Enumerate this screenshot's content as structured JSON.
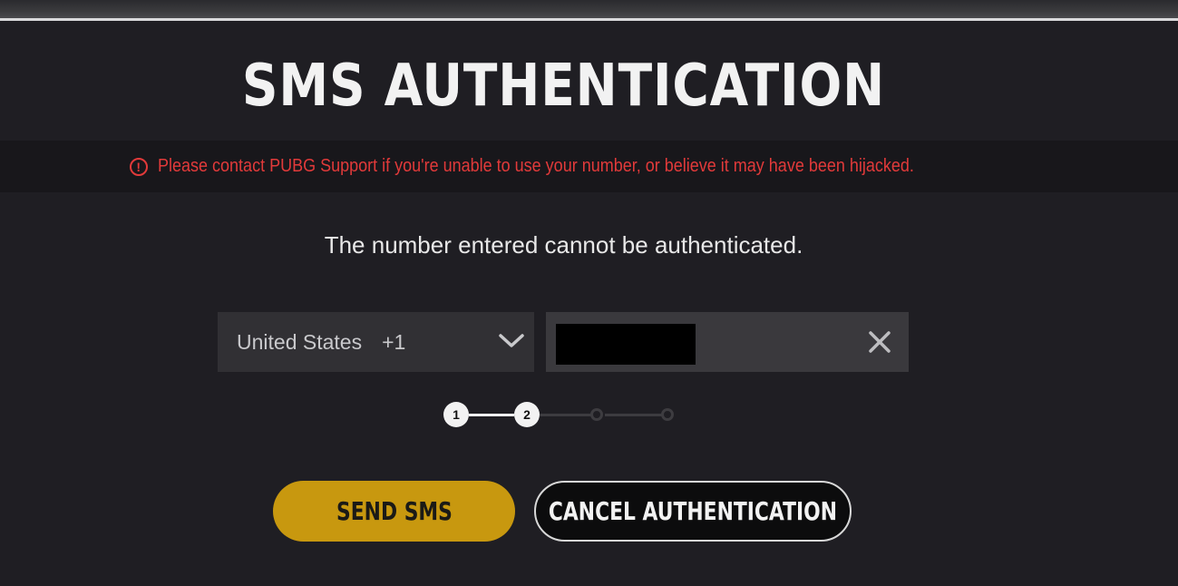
{
  "colors": {
    "background": "#1f1e23",
    "warning_bar": "#18171b",
    "error_red": "#e23a3a",
    "accent_gold": "#c8980f",
    "field_bg": "#313034"
  },
  "dialog": {
    "title": "SMS AUTHENTICATION",
    "warning": {
      "icon": "alert-circle-icon",
      "text": "Please contact PUBG Support if you're unable to use your number, or believe it may have been hijacked."
    },
    "message": "The number entered cannot be authenticated.",
    "country_select": {
      "country": "United States",
      "code": "+1",
      "icon": "chevron-down-icon"
    },
    "phone_field": {
      "value": "",
      "redacted": true,
      "clear_icon": "close-icon"
    },
    "stepper": {
      "steps": [
        "1",
        "2",
        "",
        ""
      ],
      "current_step": 2,
      "total_steps": 4
    },
    "buttons": {
      "send": "SEND SMS",
      "cancel": "CANCEL AUTHENTICATION"
    }
  }
}
